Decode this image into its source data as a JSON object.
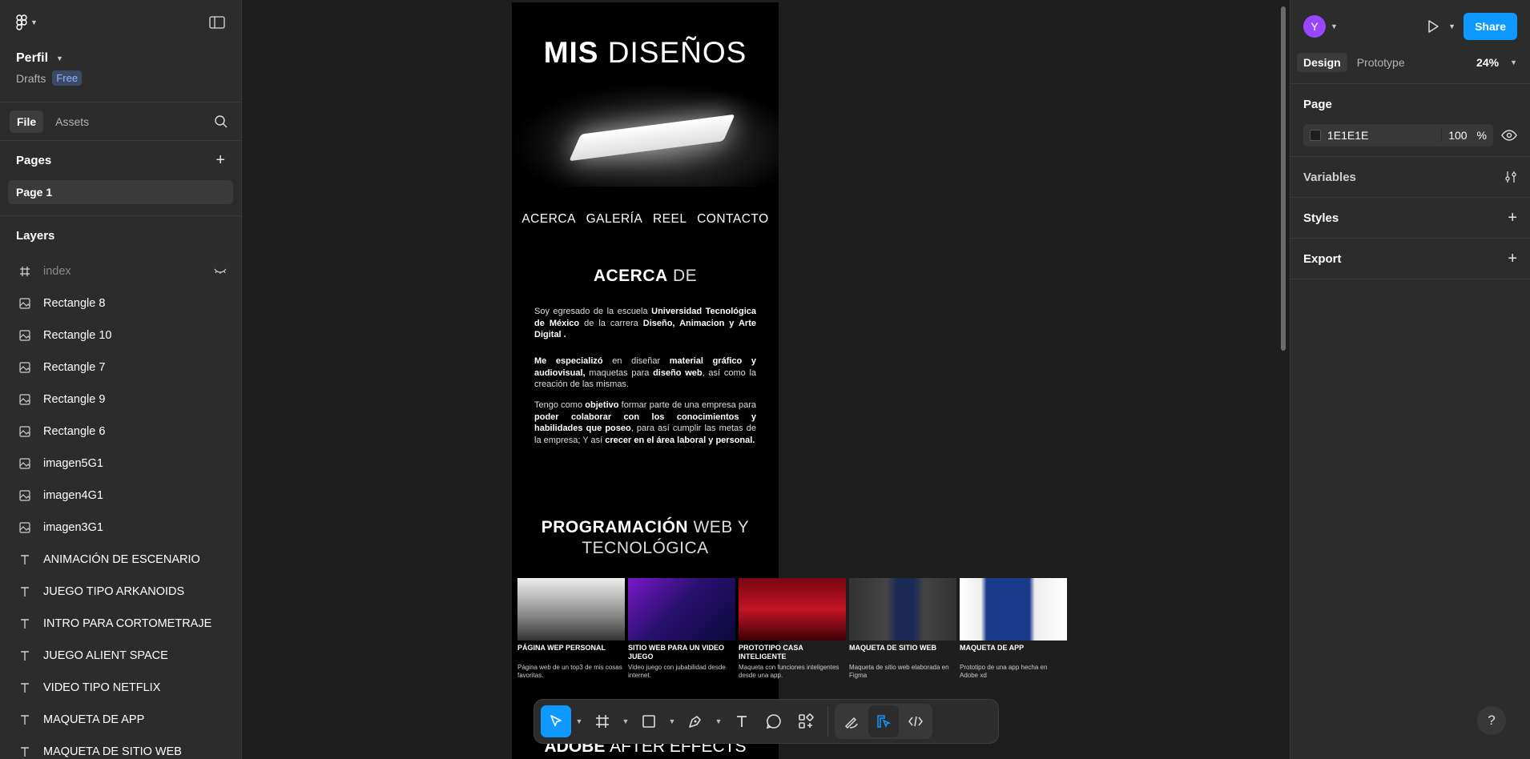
{
  "left_panel": {
    "file_name": "Perfil",
    "location": "Drafts",
    "plan_badge": "Free",
    "tabs": [
      "File",
      "Assets"
    ],
    "pages_label": "Pages",
    "pages": [
      "Page 1"
    ],
    "layers_label": "Layers",
    "layers": [
      {
        "name": "index",
        "icon": "frame-icon"
      },
      {
        "name": "Rectangle 8",
        "icon": "image-icon"
      },
      {
        "name": "Rectangle 10",
        "icon": "image-icon"
      },
      {
        "name": "Rectangle 7",
        "icon": "image-icon"
      },
      {
        "name": "Rectangle 9",
        "icon": "image-icon"
      },
      {
        "name": "Rectangle 6",
        "icon": "image-icon"
      },
      {
        "name": "imagen5G1",
        "icon": "image-icon"
      },
      {
        "name": "imagen4G1",
        "icon": "image-icon"
      },
      {
        "name": "imagen3G1",
        "icon": "image-icon"
      },
      {
        "name": "ANIMACIÓN DE ESCENARIO",
        "icon": "text-icon"
      },
      {
        "name": "JUEGO TIPO ARKANOIDS",
        "icon": "text-icon"
      },
      {
        "name": "INTRO PARA CORTOMETRAJE",
        "icon": "text-icon"
      },
      {
        "name": "JUEGO ALIENT SPACE",
        "icon": "text-icon"
      },
      {
        "name": "VIDEO TIPO NETFLIX",
        "icon": "text-icon"
      },
      {
        "name": "MAQUETA DE APP",
        "icon": "text-icon"
      },
      {
        "name": "MAQUETA DE SITIO WEB",
        "icon": "text-icon"
      }
    ]
  },
  "canvas": {
    "title_bold": "MIS",
    "title_light": "DISEÑOS",
    "nav": [
      "ACERCA",
      "GALERÍA",
      "REEL",
      "CONTACTO"
    ],
    "about_bold": "ACERCA",
    "about_light": "DE",
    "p1": [
      {
        "t": "Soy egresado de la escuela ",
        "b": false
      },
      {
        "t": "Universidad Tecnológica de México",
        "b": true
      },
      {
        "t": " de la carrera ",
        "b": false
      },
      {
        "t": "Diseño, Animacion y Arte Digital .",
        "b": true
      }
    ],
    "p2": [
      {
        "t": "Me especializó",
        "b": true
      },
      {
        "t": " en diseñar ",
        "b": false
      },
      {
        "t": "material gráfico y audiovisual,",
        "b": true
      },
      {
        "t": " maquetas para ",
        "b": false
      },
      {
        "t": "diseño web",
        "b": true
      },
      {
        "t": ", así como la creación de las mismas.",
        "b": false
      }
    ],
    "p3": [
      {
        "t": "Tengo como ",
        "b": false
      },
      {
        "t": "objetivo",
        "b": true
      },
      {
        "t": " formar parte de una empresa para ",
        "b": false
      },
      {
        "t": "poder colaborar con los conocimientos y habilidades que poseo",
        "b": true
      },
      {
        "t": ", para así cumplir las metas de la empresa; Y así ",
        "b": false
      },
      {
        "t": "crecer en el área laboral y personal.",
        "b": true
      }
    ],
    "prog_bold": "PROGRAMACIÓN",
    "prog_light_1": "WEB Y",
    "prog_light_2": "TECNOLÓGICA",
    "cards": [
      {
        "title": "PÁGINA WEP PERSONAL",
        "desc": "Página web de un top3 de mis cosas favoritas.",
        "thumb": "t1"
      },
      {
        "title": "SITIO WEB PARA UN VIDEO JUEGO",
        "desc": "Video juego con jubabilidad desde internet.",
        "thumb": "t2"
      },
      {
        "title": "PROTOTIPO CASA INTELIGENTE",
        "desc": "Maqueta con funciones inteligentes desde una app.",
        "thumb": "t3"
      },
      {
        "title": "MAQUETA DE SITIO WEB",
        "desc": "Maqueta de sitio web elaborada en Figma",
        "thumb": "t4"
      },
      {
        "title": "MAQUETA DE APP",
        "desc": "Prototipo de una app hecha en Adobe xd",
        "thumb": "t5"
      }
    ],
    "bottom_bold": "ADOBE",
    "bottom_light": "AFTER EFFECTS"
  },
  "right_panel": {
    "avatar_letter": "Y",
    "share_label": "Share",
    "tabs": [
      "Design",
      "Prototype"
    ],
    "zoom": "24%",
    "page_label": "Page",
    "page_color": "1E1E1E",
    "page_opacity": "100",
    "percent_sign": "%",
    "variables_label": "Variables",
    "styles_label": "Styles",
    "export_label": "Export",
    "help_label": "?"
  },
  "colors": {
    "accent": "#0d99ff",
    "canvas_bg": "#1e1e1e",
    "panel_bg": "#2c2c2c",
    "avatar": "#9747ff"
  }
}
